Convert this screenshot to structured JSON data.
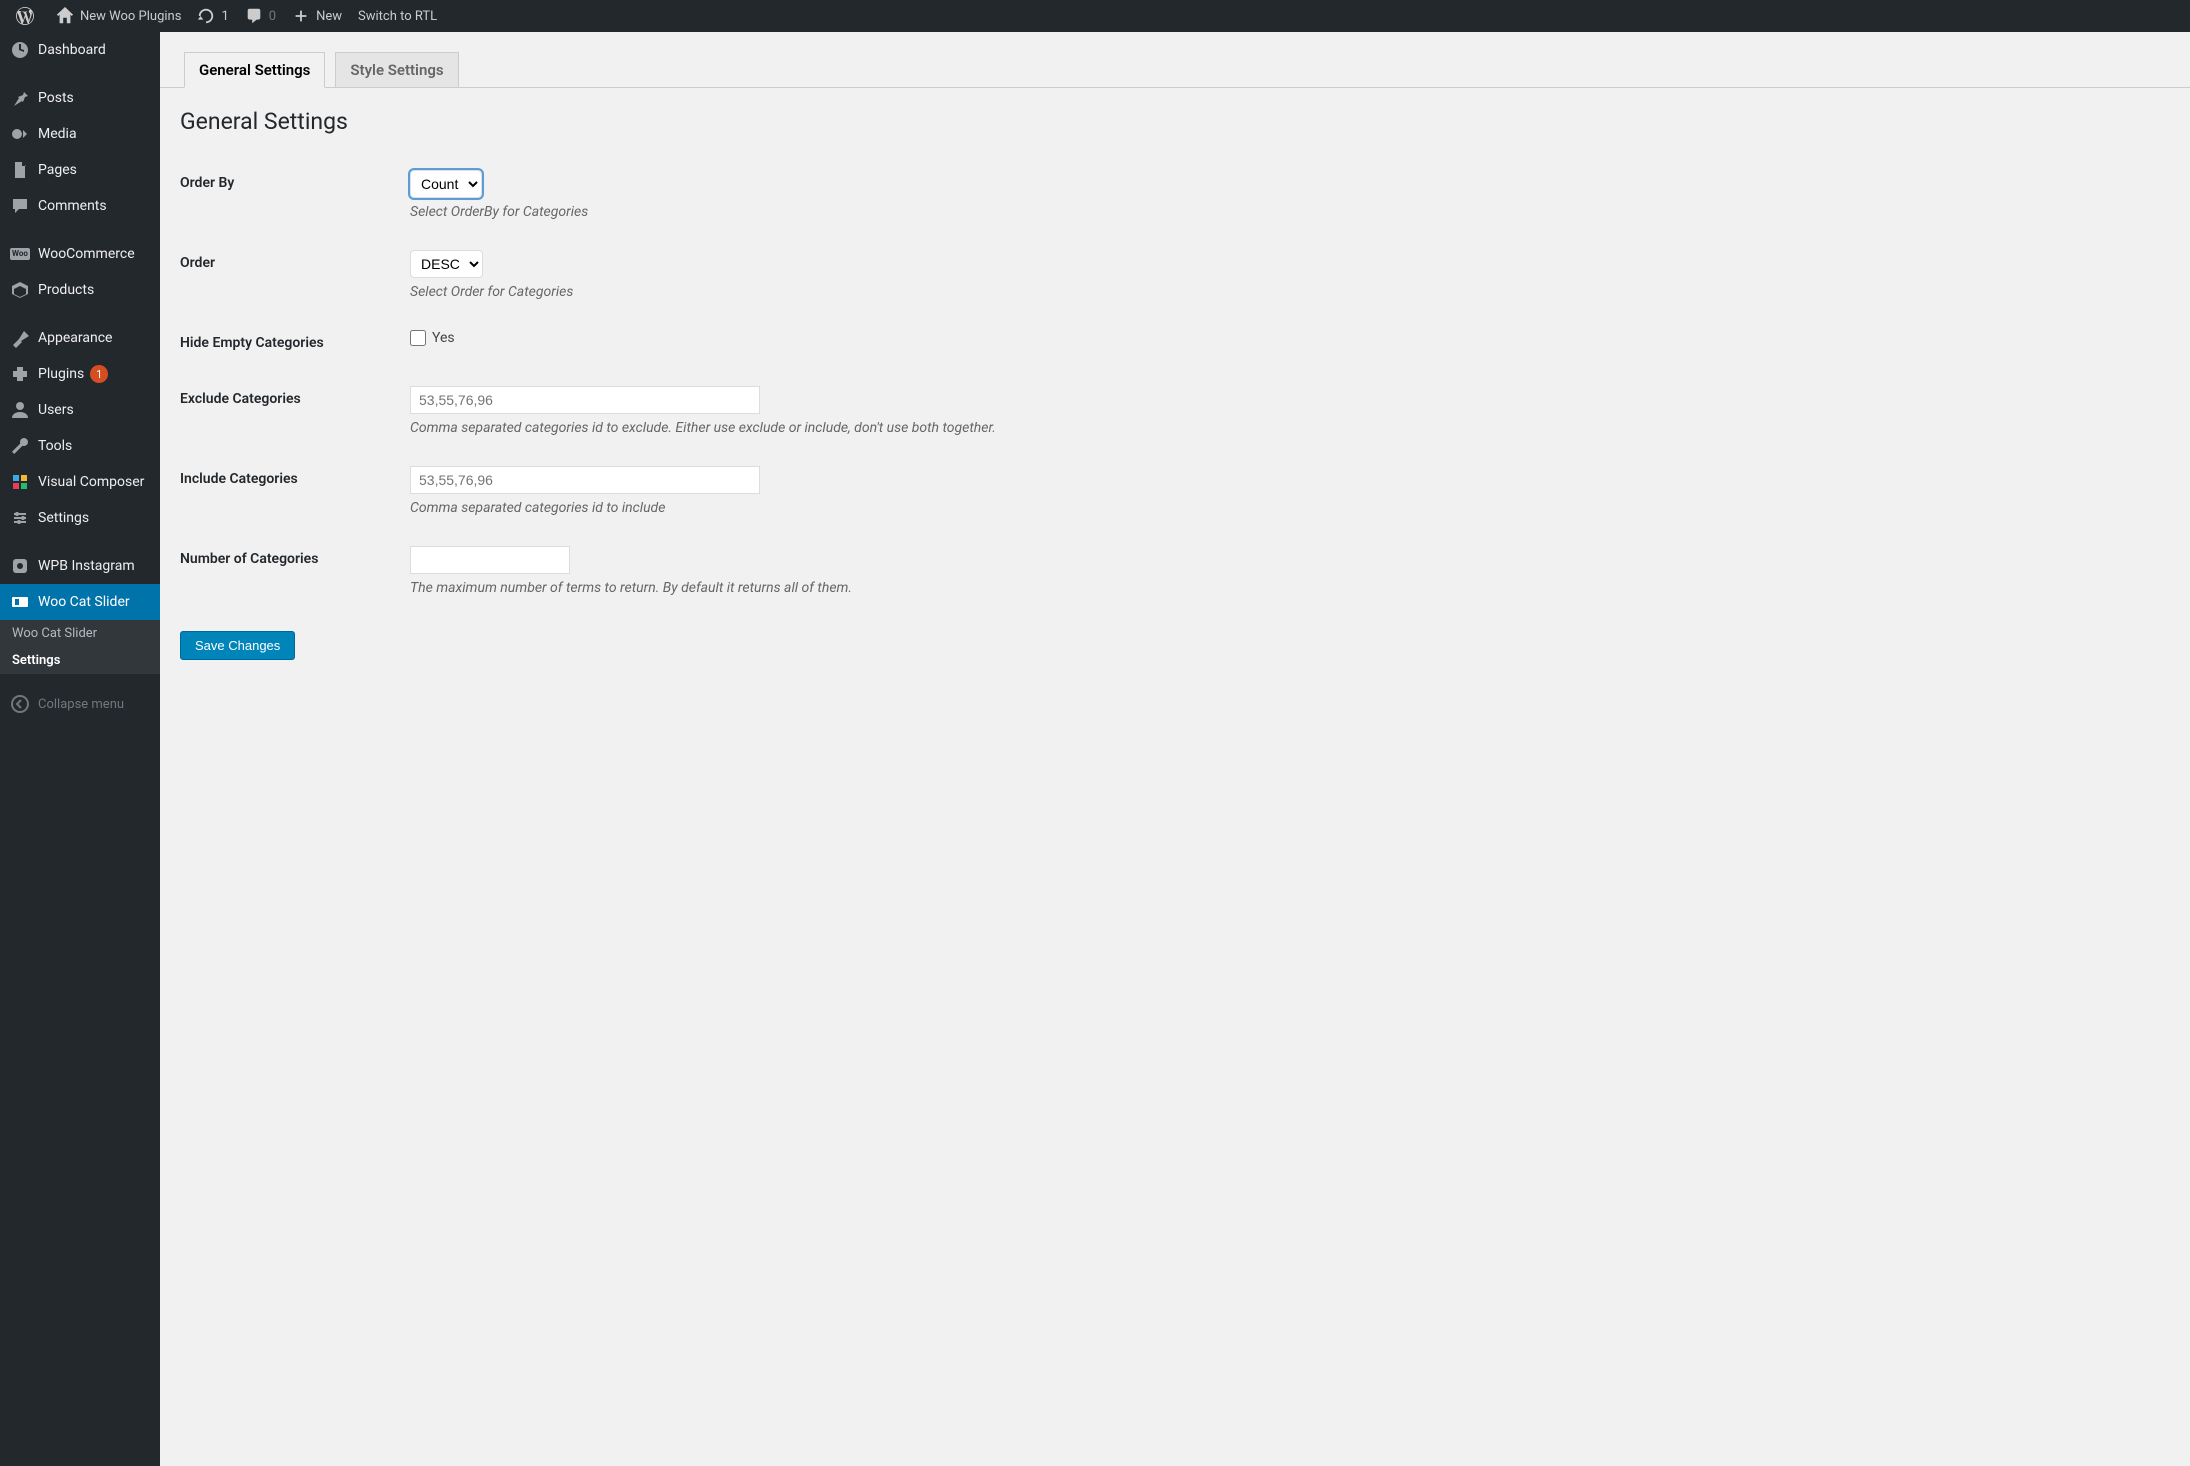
{
  "admin_bar": {
    "site_name": "New Woo Plugins",
    "updates_count": "1",
    "comments_count": "0",
    "new_label": "New",
    "rtl_label": "Switch to RTL"
  },
  "sidebar": {
    "items": [
      {
        "label": "Dashboard"
      },
      {
        "label": "Posts"
      },
      {
        "label": "Media"
      },
      {
        "label": "Pages"
      },
      {
        "label": "Comments"
      },
      {
        "label": "WooCommerce"
      },
      {
        "label": "Products"
      },
      {
        "label": "Appearance"
      },
      {
        "label": "Plugins",
        "badge": "1"
      },
      {
        "label": "Users"
      },
      {
        "label": "Tools"
      },
      {
        "label": "Visual Composer"
      },
      {
        "label": "Settings"
      },
      {
        "label": "WPB Instagram"
      },
      {
        "label": "Woo Cat Slider"
      }
    ],
    "submenu": [
      {
        "label": "Woo Cat Slider"
      },
      {
        "label": "Settings"
      }
    ],
    "collapse": "Collapse menu"
  },
  "tabs": [
    {
      "label": "General Settings",
      "active": true
    },
    {
      "label": "Style Settings",
      "active": false
    }
  ],
  "page": {
    "title": "General Settings",
    "fields": {
      "order_by": {
        "label": "Order By",
        "value": "Count",
        "help": "Select OrderBy for Categories"
      },
      "order": {
        "label": "Order",
        "value": "DESC",
        "help": "Select Order for Categories"
      },
      "hide_empty": {
        "label": "Hide Empty Categories",
        "option": "Yes"
      },
      "exclude": {
        "label": "Exclude Categories",
        "placeholder": "53,55,76,96",
        "help": "Comma separated categories id to exclude. Either use exclude or include, don't use both together."
      },
      "include": {
        "label": "Include Categories",
        "placeholder": "53,55,76,96",
        "help": "Comma separated categories id to include"
      },
      "number": {
        "label": "Number of Categories",
        "help": "The maximum number of terms to return. By default it returns all of them."
      }
    },
    "save": "Save Changes"
  }
}
